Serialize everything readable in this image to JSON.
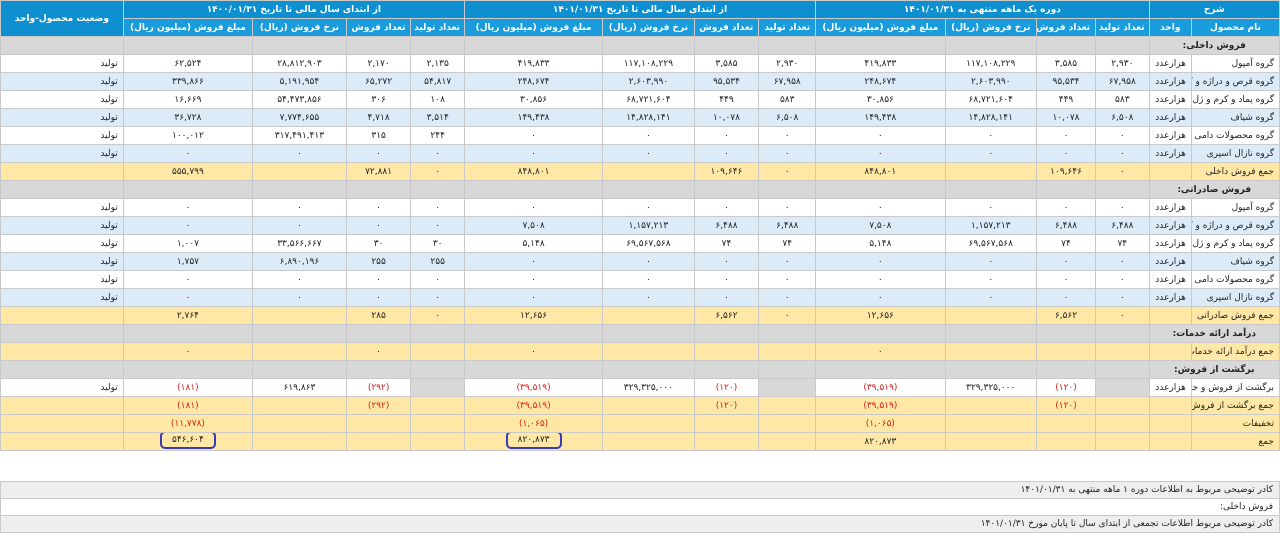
{
  "header": {
    "desc": "شرح",
    "col_groups": [
      "دوره یک ماهه منتهی به ۱۴۰۱/۰۱/۳۱",
      "از ابتدای سال مالی تا تاریخ ۱۴۰۱/۰۱/۳۱",
      "از ابتدای سال مالی تا تاریخ ۱۴۰۰/۰۱/۳۱"
    ],
    "status_header": "وضعیت محصول-واحد",
    "product_name": "نام محصول",
    "unit": "واحد",
    "sub": [
      "تعداد تولید",
      "تعداد فروش",
      "نرخ فروش (ریال)",
      "مبلغ فروش (میلیون ریال)"
    ],
    "sub_last": [
      "تعداد تولید",
      "تعداد فروش",
      "نرخ فروش (ریال)",
      "مبلغ فروش (میلیون ریال)"
    ]
  },
  "sections": {
    "domestic": "فروش داخلی:",
    "export": "فروش صادراتی:",
    "services": "درآمد ارائه خدمات:",
    "returns": "برگشت از فروش:"
  },
  "domestic_rows": [
    {
      "name": "گروه آمپول",
      "unit": "هزارعدد",
      "c": [
        "۲,۹۳۰",
        "۳,۵۸۵",
        "۱۱۷,۱۰۸,۲۲۹",
        "۴۱۹,۸۳۳",
        "۲,۹۳۰",
        "۳,۵۸۵",
        "۱۱۷,۱۰۸,۲۲۹",
        "۴۱۹,۸۳۳",
        "۲,۱۳۵",
        "۲,۱۷۰",
        "۲۸,۸۱۲,۹۰۳",
        "۶۲,۵۲۴"
      ],
      "status": "تولید"
    },
    {
      "name": "گروه قرص و دراژه و کپسول",
      "unit": "هزارعدد",
      "c": [
        "۶۷,۹۵۸",
        "۹۵,۵۳۴",
        "۲,۶۰۳,۹۹۰",
        "۲۴۸,۶۷۴",
        "۶۷,۹۵۸",
        "۹۵,۵۳۴",
        "۲,۶۰۳,۹۹۰",
        "۲۴۸,۶۷۴",
        "۵۴,۸۱۷",
        "۶۵,۲۷۲",
        "۵,۱۹۱,۹۵۴",
        "۳۳۹,۸۶۶"
      ],
      "status": "تولید"
    },
    {
      "name": "گروه پماد و کرم و ژل",
      "unit": "هزارعدد",
      "c": [
        "۵۸۳",
        "۴۴۹",
        "۶۸,۷۲۱,۶۰۴",
        "۳۰,۸۵۶",
        "۵۸۳",
        "۴۴۹",
        "۶۸,۷۲۱,۶۰۴",
        "۳۰,۸۵۶",
        "۱۰۸",
        "۳۰۶",
        "۵۴,۴۷۳,۸۵۶",
        "۱۶,۶۶۹"
      ],
      "status": "تولید"
    },
    {
      "name": "گروه شیاف",
      "unit": "هزارعدد",
      "c": [
        "۶,۵۰۸",
        "۱۰,۰۷۸",
        "۱۴,۸۲۸,۱۴۱",
        "۱۴۹,۴۳۸",
        "۶,۵۰۸",
        "۱۰,۰۷۸",
        "۱۴,۸۲۸,۱۴۱",
        "۱۴۹,۴۳۸",
        "۳,۵۱۴",
        "۴,۷۱۸",
        "۷,۷۷۴,۶۵۵",
        "۳۶,۷۲۸"
      ],
      "status": "تولید"
    },
    {
      "name": "گروه محصولات دامی",
      "unit": "هزارعدد",
      "c": [
        "۰",
        "۰",
        "۰",
        "۰",
        "۰",
        "۰",
        "۰",
        "۰",
        "۲۴۴",
        "۳۱۵",
        "۳۱۷,۴۹۱,۴۱۳",
        "۱۰۰,۰۱۲"
      ],
      "status": "تولید"
    },
    {
      "name": "گروه نازال اسپری",
      "unit": "هزارعدد",
      "c": [
        "۰",
        "۰",
        "۰",
        "۰",
        "۰",
        "۰",
        "۰",
        "۰",
        "۰",
        "۰",
        "۰",
        "۰"
      ],
      "status": "تولید"
    }
  ],
  "domestic_total": {
    "name": "جمع فروش داخلی",
    "c": [
      "۰",
      "۱۰۹,۶۴۶",
      "",
      "۸۴۸,۸۰۱",
      "۰",
      "۱۰۹,۶۴۶",
      "",
      "۸۴۸,۸۰۱",
      "۰",
      "۷۲,۸۸۱",
      "",
      "۵۵۵,۷۹۹"
    ]
  },
  "export_rows": [
    {
      "name": "گروه آمپول",
      "unit": "هزارعدد",
      "c": [
        "۰",
        "۰",
        "۰",
        "۰",
        "۰",
        "۰",
        "۰",
        "۰",
        "۰",
        "۰",
        "۰",
        "۰"
      ],
      "status": "تولید"
    },
    {
      "name": "گروه قرص و دراژه و کپسول",
      "unit": "هزارعدد",
      "c": [
        "۶,۴۸۸",
        "۶,۴۸۸",
        "۱,۱۵۷,۲۱۳",
        "۷,۵۰۸",
        "۶,۴۸۸",
        "۶,۴۸۸",
        "۱,۱۵۷,۲۱۳",
        "۷,۵۰۸",
        "۰",
        "۰",
        "۰",
        "۰"
      ],
      "status": "تولید"
    },
    {
      "name": "گروه پماد و کرم و ژل",
      "unit": "هزارعدد",
      "c": [
        "۷۴",
        "۷۴",
        "۶۹,۵۶۷,۵۶۸",
        "۵,۱۴۸",
        "۷۴",
        "۷۴",
        "۶۹,۵۶۷,۵۶۸",
        "۵,۱۴۸",
        "۳۰",
        "۳۰",
        "۳۳,۵۶۶,۶۶۷",
        "۱,۰۰۷"
      ],
      "status": "تولید"
    },
    {
      "name": "گروه شیاف",
      "unit": "هزارعدد",
      "c": [
        "۰",
        "۰",
        "۰",
        "۰",
        "۰",
        "۰",
        "۰",
        "۰",
        "۲۵۵",
        "۲۵۵",
        "۶,۸۹۰,۱۹۶",
        "۱,۷۵۷"
      ],
      "status": "تولید"
    },
    {
      "name": "گروه محصولات دامی",
      "unit": "هزارعدد",
      "c": [
        "۰",
        "۰",
        "۰",
        "۰",
        "۰",
        "۰",
        "۰",
        "۰",
        "۰",
        "۰",
        "۰",
        "۰"
      ],
      "status": "تولید"
    },
    {
      "name": "گروه نازال اسپری",
      "unit": "هزارعدد",
      "c": [
        "۰",
        "۰",
        "۰",
        "۰",
        "۰",
        "۰",
        "۰",
        "۰",
        "۰",
        "۰",
        "۰",
        "۰"
      ],
      "status": "تولید"
    }
  ],
  "export_total": {
    "name": "جمع فروش صادراتی",
    "c": [
      "۰",
      "۶,۵۶۲",
      "",
      "۱۲,۶۵۶",
      "۰",
      "۶,۵۶۲",
      "",
      "۱۲,۶۵۶",
      "۰",
      "۲۸۵",
      "",
      "۲,۷۶۴"
    ]
  },
  "services_total": {
    "name": "جمع درآمد ارائه خدمات",
    "c": [
      "",
      "",
      "",
      "۰",
      "",
      "",
      "",
      "۰",
      "",
      "۰",
      "",
      "۰"
    ]
  },
  "returns_rows": [
    {
      "name": "برگشت از فروش و جابجایی",
      "unit": "هزارعدد",
      "c": [
        "",
        "(۱۲۰)",
        "۳۲۹,۳۲۵,۰۰۰",
        "(۳۹,۵۱۹)",
        "",
        "(۱۲۰)",
        "۳۲۹,۳۲۵,۰۰۰",
        "(۳۹,۵۱۹)",
        "",
        "(۲۹۲)",
        "۶۱۹,۸۶۳",
        "(۱۸۱)"
      ],
      "status": "تولید"
    }
  ],
  "returns_total": {
    "name": "جمع برگشت از فروش",
    "c": [
      "",
      "(۱۲۰)",
      "",
      "(۳۹,۵۱۹)",
      "",
      "(۱۲۰)",
      "",
      "(۳۹,۵۱۹)",
      "",
      "(۲۹۲)",
      "",
      "(۱۸۱)"
    ]
  },
  "discounts": {
    "name": "تخفیفات",
    "v": [
      "(۱,۰۶۵)",
      "(۱,۰۶۵)",
      "(۱۱,۷۷۸)"
    ]
  },
  "grand_total": {
    "name": "جمع",
    "v": [
      "۸۲۰,۸۷۳",
      "۸۲۰,۸۷۳",
      "۵۴۶,۶۰۴"
    ]
  },
  "notes": [
    "کادر توضیحی مربوط به اطلاعات دوره ۱ ماهه منتهی به ۱۴۰۱/۰۱/۳۱",
    "فروش داخلی:",
    "کادر توضیحی مربوط اطلاعات تجمعی از ابتدای سال تا پایان مورخ ۱۴۰۱/۰۱/۳۱"
  ]
}
